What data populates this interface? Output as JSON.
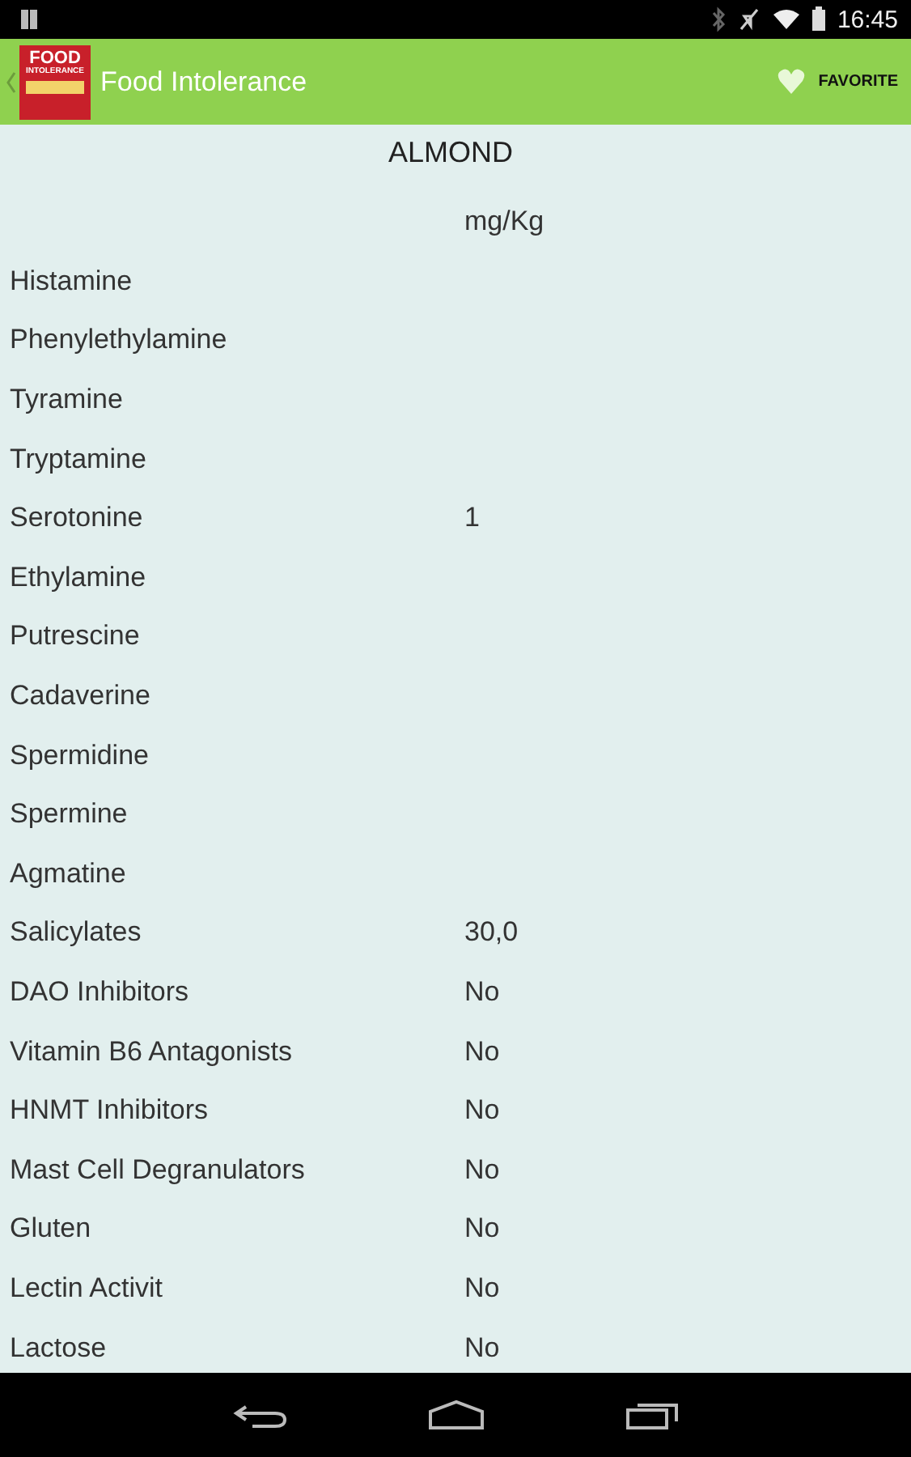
{
  "status_bar": {
    "time": "16:45"
  },
  "app_bar": {
    "logo": [
      "FOOD",
      "INTOLERANCE"
    ],
    "title": "Food Intolerance",
    "favorite": {
      "label": "FAVORITE"
    }
  },
  "food": {
    "name": "ALMOND",
    "unit": "mg/Kg"
  },
  "rows": [
    {
      "name": "Histamine",
      "value": ""
    },
    {
      "name": "Phenylethylamine",
      "value": ""
    },
    {
      "name": "Tyramine",
      "value": ""
    },
    {
      "name": "Tryptamine",
      "value": ""
    },
    {
      "name": "Serotonine",
      "value": "1"
    },
    {
      "name": "Ethylamine",
      "value": ""
    },
    {
      "name": "Putrescine",
      "value": ""
    },
    {
      "name": "Cadaverine",
      "value": ""
    },
    {
      "name": "Spermidine",
      "value": ""
    },
    {
      "name": "Spermine",
      "value": ""
    },
    {
      "name": "Agmatine",
      "value": ""
    },
    {
      "name": "Salicylates",
      "value": "30,0"
    },
    {
      "name": "DAO Inhibitors",
      "value": "No"
    },
    {
      "name": "Vitamin B6 Antagonists",
      "value": "No"
    },
    {
      "name": "HNMT Inhibitors",
      "value": "No"
    },
    {
      "name": "Mast Cell Degranulators",
      "value": "No"
    },
    {
      "name": "Gluten",
      "value": "No"
    },
    {
      "name": "Lectin Activit",
      "value": "No"
    },
    {
      "name": "Lactose",
      "value": "No"
    }
  ]
}
